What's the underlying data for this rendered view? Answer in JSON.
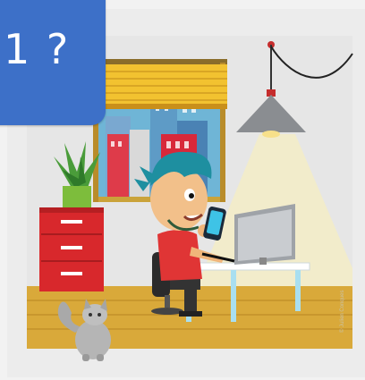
{
  "badge": {
    "text": "1 ?"
  },
  "illustration": {
    "credit": "© Julien Conques",
    "colors": {
      "badge": "#3d70c8",
      "floor": "#d9a93a",
      "wall": "#e8e8e8",
      "cabinet": "#d8282c",
      "hair": "#1e8fa0",
      "shirt": "#e03535",
      "blinds": "#f2c230"
    }
  }
}
